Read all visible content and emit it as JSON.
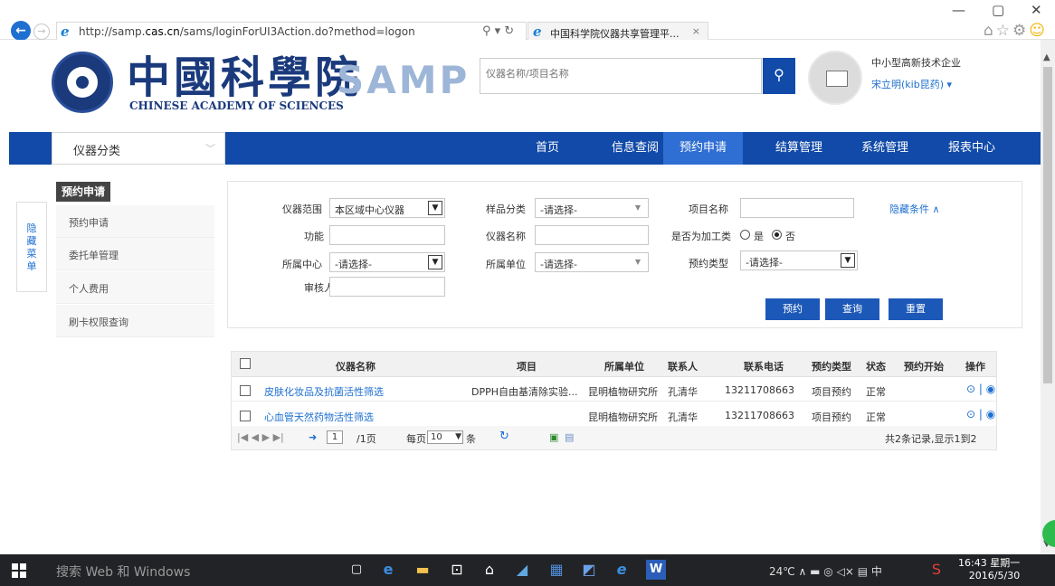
{
  "browser": {
    "url_prefix": "http://samp.",
    "url_domain": "cas.cn",
    "url_suffix": "/sams/loginForUI3Action.do?method=logon",
    "addr_icons": "⚲ ▾ ↻",
    "tab_title": "中国科学院仪器共享管理平...",
    "tab_close": "×",
    "win_min": "—",
    "win_max": "▢",
    "win_close": "✕"
  },
  "header": {
    "logo_cn": "中國科學院",
    "logo_en": "CHINESE ACADEMY OF SCIENCES",
    "logo_samp": "SAMP",
    "search_placeholder": "仪器名称/项目名称",
    "user_company": "中小型高新技术企业",
    "user_name": "宋立明(kib昆药) ▾"
  },
  "nav": {
    "category_label": "仪器分类",
    "items": [
      "首页",
      "信息查阅",
      "预约申请",
      "结算管理",
      "系统管理",
      "报表中心"
    ],
    "active": "预约申请"
  },
  "sidebar": {
    "hide_menu": [
      "隐",
      "藏",
      "菜",
      "单"
    ],
    "title": "预约申请",
    "items": [
      "预约申请",
      "委托单管理",
      "个人费用",
      "刷卡权限查询"
    ]
  },
  "filters": {
    "scope_label": "仪器范围",
    "scope_value": "本区域中心仪器",
    "sample_label": "样品分类",
    "sample_value": "-请选择-",
    "project_label": "项目名称",
    "hide_conditions": "隐藏条件 ∧",
    "function_label": "功能",
    "instrument_label": "仪器名称",
    "processing_label": "是否为加工类",
    "processing_yes": "是",
    "processing_no": "否",
    "processing_selected": "否",
    "center_label": "所属中心",
    "center_value": "-请选择-",
    "unit_label": "所属单位",
    "unit_value": "-请选择-",
    "type_label": "预约类型",
    "type_value": "-请选择-",
    "reviewer_label": "审核人",
    "btn_reserve": "预约",
    "btn_query": "查询",
    "btn_reset": "重置"
  },
  "table": {
    "headers": [
      "仪器名称",
      "项目",
      "所属单位",
      "联系人",
      "联系电话",
      "预约类型",
      "状态",
      "预约开始",
      "操作"
    ],
    "rows": [
      [
        "皮肤化妆品及抗菌活性筛选",
        "DPPH自由基清除实验...",
        "昆明植物研究所",
        "孔清华",
        "13211708663",
        "项目预约",
        "正常",
        ""
      ],
      [
        "心血管天然药物活性筛选",
        "",
        "昆明植物研究所",
        "孔清华",
        "13211708663",
        "项目预约",
        "正常",
        ""
      ]
    ],
    "ops": "⊙ | ◉"
  },
  "pager": {
    "nav_icons": "|◀ ◀ ▶ ▶|",
    "go_icon": "➜",
    "page": "1",
    "of_pages": "/1页",
    "per_page_label": "每页",
    "per_page": "10",
    "per_page_unit": "条",
    "summary": "共2条记录,显示1到2"
  },
  "taskbar": {
    "search_text": "搜索 Web 和 Windows",
    "tray_text": "24℃ ∧ ▬ ◎ ◁× ▤ 中",
    "time": "16:43 星期一",
    "date": "2016/5/30"
  },
  "colors": {
    "nav_bg": "#114aa8",
    "nav_active": "#2f6ed3",
    "link": "#1e6fd0",
    "button": "#1c58b8"
  }
}
